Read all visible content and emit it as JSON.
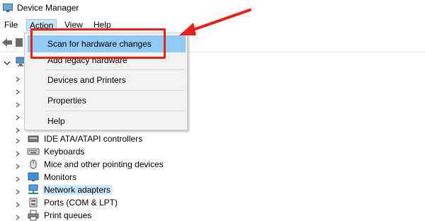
{
  "window": {
    "title": "Device Manager"
  },
  "menubar": {
    "items": [
      "File",
      "Action",
      "View",
      "Help"
    ]
  },
  "action_menu": {
    "items": [
      {
        "label": "Scan for hardware changes"
      },
      {
        "label": "Add legacy hardware"
      },
      {
        "label": "Devices and Printers"
      },
      {
        "label": "Properties"
      },
      {
        "label": "Help"
      }
    ]
  },
  "tree": {
    "categories": [
      {
        "label": "IDE ATA/ATAPI controllers",
        "icon": "ide-controller-icon"
      },
      {
        "label": "Keyboards",
        "icon": "keyboard-icon"
      },
      {
        "label": "Mice and other pointing devices",
        "icon": "mouse-icon"
      },
      {
        "label": "Monitors",
        "icon": "monitor-icon"
      },
      {
        "label": "Network adapters",
        "icon": "network-adapter-icon",
        "selected": true
      },
      {
        "label": "Ports (COM & LPT)",
        "icon": "port-icon"
      },
      {
        "label": "Print queues",
        "icon": "printer-icon"
      }
    ]
  },
  "colors": {
    "highlight": "#e8201c",
    "menu_hover": "#91c9f7",
    "selection": "#cce8ff"
  }
}
